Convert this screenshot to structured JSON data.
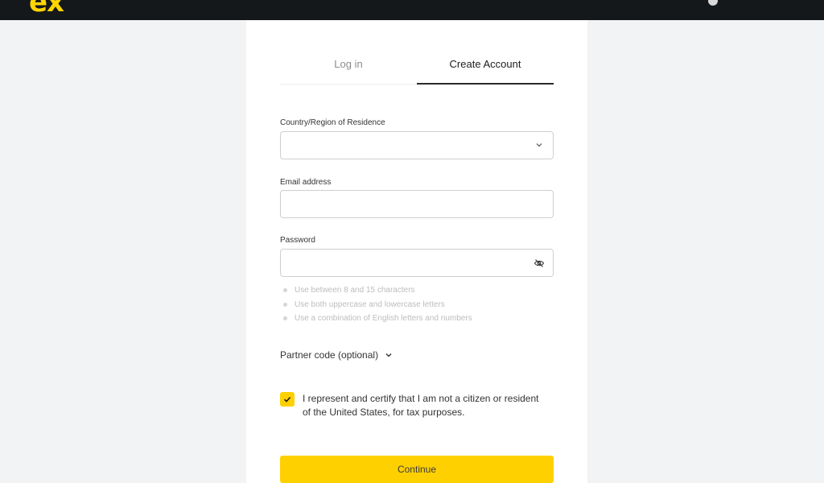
{
  "brand": {
    "logo_text": "ex",
    "accent": "#ffd000"
  },
  "header": {
    "language": "",
    "globe_icon": "globe-icon"
  },
  "tabs": [
    {
      "label": "Log in",
      "active": false
    },
    {
      "label": "Create Account",
      "active": true
    }
  ],
  "form": {
    "country": {
      "label": "Country/Region of Residence",
      "value": "",
      "icon": "chevron-down-icon"
    },
    "email": {
      "label": "Email address",
      "value": "",
      "placeholder": ""
    },
    "password": {
      "label": "Password",
      "value": "",
      "icon": "eye-off-icon"
    },
    "password_rules": [
      "Use between 8 and 15 characters",
      "Use both uppercase and lowercase letters",
      "Use a combination of English letters and numbers"
    ],
    "partner_code_label": "Partner code (optional)",
    "consent": {
      "checked": true,
      "text_line1": "I represent and certify that I am not a citizen or resident",
      "text_line2": "of the United States, for tax purposes."
    },
    "continue_label": "Continue"
  }
}
